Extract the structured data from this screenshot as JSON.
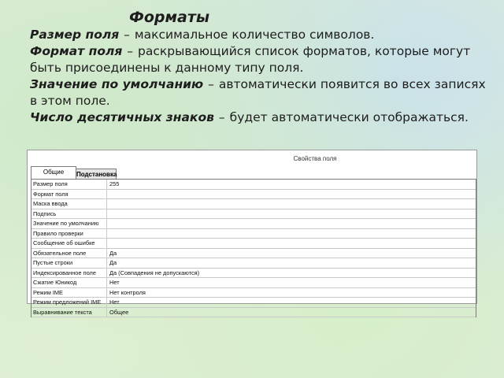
{
  "slide": {
    "title": "Форматы",
    "paragraphs": [
      {
        "term": "Размер поля",
        "dash": "–",
        "text": "максимальное количество символов."
      },
      {
        "term": "Формат поля",
        "dash": "–",
        "text": "раскрывающийся список форматов, которые могут быть присоединены к данному типу поля."
      },
      {
        "term": "Значение по умолчанию",
        "dash": "–",
        "text": "автоматически появится во всех записях в этом поле."
      },
      {
        "term": "Число десятичных знаков",
        "dash": "–",
        "text": "будет автоматически отображаться."
      }
    ]
  },
  "panel": {
    "caption": "Свойства поля",
    "tabs": [
      {
        "label": "Общие",
        "active": true
      },
      {
        "label": "Подстановка",
        "active": false
      }
    ],
    "rows": [
      {
        "name": "Размер поля",
        "value": "255"
      },
      {
        "name": "Формат поля",
        "value": ""
      },
      {
        "name": "Маска ввода",
        "value": ""
      },
      {
        "name": "Подпись",
        "value": ""
      },
      {
        "name": "Значение по умолчанию",
        "value": ""
      },
      {
        "name": "Правило проверки",
        "value": ""
      },
      {
        "name": "Сообщение об ошибке",
        "value": ""
      },
      {
        "name": "Обязательное поле",
        "value": "Да"
      },
      {
        "name": "Пустые строки",
        "value": "Да"
      },
      {
        "name": "Индексированное поле",
        "value": "Да (Совпадения не допускаются)"
      },
      {
        "name": "Сжатие Юникод",
        "value": "Нет"
      },
      {
        "name": "Режим IME",
        "value": "Нет контроля"
      },
      {
        "name": "Режим предложений IME",
        "value": "Нет"
      },
      {
        "name": "Выравнивание текста",
        "value": "Общее"
      }
    ]
  }
}
